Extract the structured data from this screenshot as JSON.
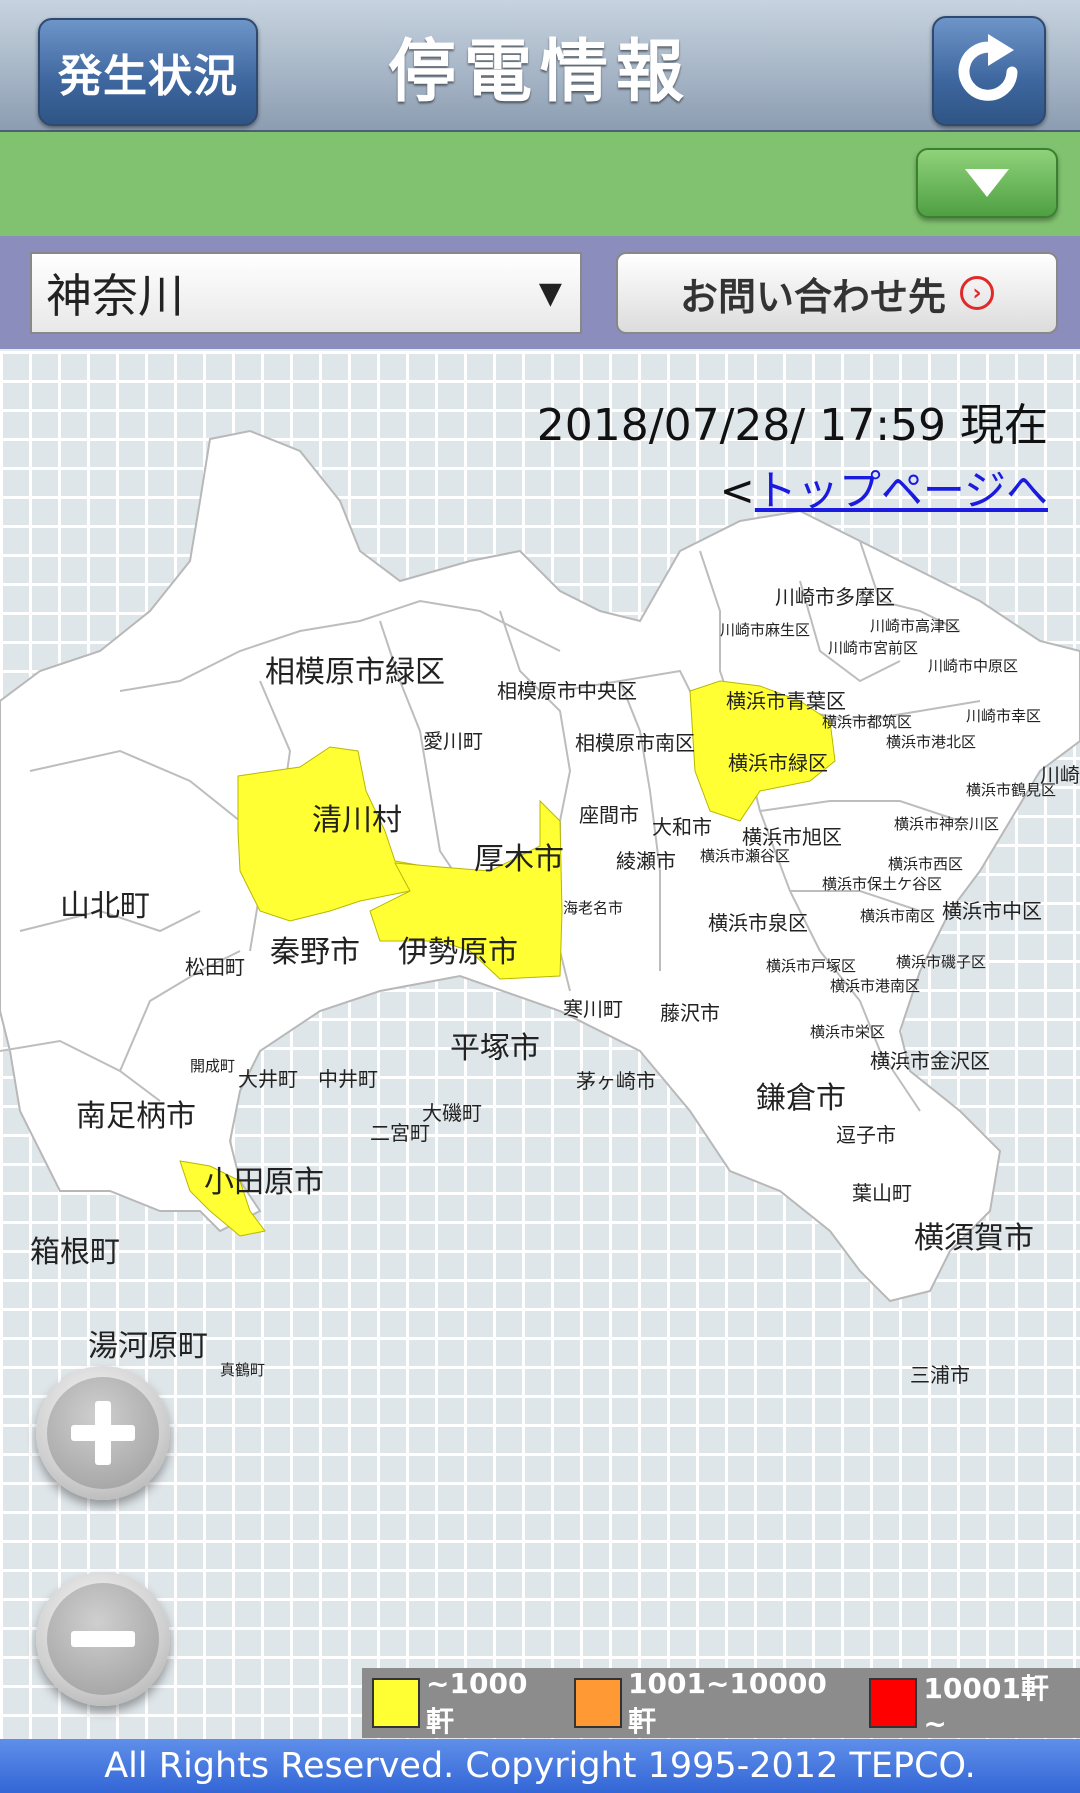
{
  "header": {
    "status_button": "発生状況",
    "title": "停電情報",
    "refresh_icon": "refresh-icon"
  },
  "toolbar": {
    "dropdown_icon": "chevron-down-icon"
  },
  "region": {
    "selected": "神奈川",
    "contact_button": "お問い合わせ先"
  },
  "map": {
    "timestamp": "2018/07/28/ 17:59 現在",
    "top_link_prefix": "<",
    "top_link": "トップページへ",
    "affected_color": "#ffff33",
    "labels": [
      {
        "text": "相模原市緑区",
        "size": "lg"
      },
      {
        "text": "相模原市中央区",
        "size": "md"
      },
      {
        "text": "相模原市南区",
        "size": "md"
      },
      {
        "text": "愛川町",
        "size": "md"
      },
      {
        "text": "清川村",
        "size": "lg"
      },
      {
        "text": "厚木市",
        "size": "lg"
      },
      {
        "text": "山北町",
        "size": "lg"
      },
      {
        "text": "座間市",
        "size": "md"
      },
      {
        "text": "大和市",
        "size": "md"
      },
      {
        "text": "綾瀬市",
        "size": "md"
      },
      {
        "text": "海老名市",
        "size": "sm"
      },
      {
        "text": "秦野市",
        "size": "lg"
      },
      {
        "text": "伊勢原市",
        "size": "lg"
      },
      {
        "text": "松田町",
        "size": "md"
      },
      {
        "text": "平塚市",
        "size": "lg"
      },
      {
        "text": "寒川町",
        "size": "md"
      },
      {
        "text": "藤沢市",
        "size": "md"
      },
      {
        "text": "茅ヶ崎市",
        "size": "md"
      },
      {
        "text": "開成町",
        "size": "sm"
      },
      {
        "text": "大井町",
        "size": "md"
      },
      {
        "text": "中井町",
        "size": "md"
      },
      {
        "text": "大磯町",
        "size": "md"
      },
      {
        "text": "二宮町",
        "size": "md"
      },
      {
        "text": "南足柄市",
        "size": "lg"
      },
      {
        "text": "小田原市",
        "size": "lg"
      },
      {
        "text": "箱根町",
        "size": "lg"
      },
      {
        "text": "湯河原町",
        "size": "lg"
      },
      {
        "text": "真鶴町",
        "size": "sm"
      },
      {
        "text": "鎌倉市",
        "size": "lg"
      },
      {
        "text": "逗子市",
        "size": "md"
      },
      {
        "text": "葉山町",
        "size": "md"
      },
      {
        "text": "横須賀市",
        "size": "lg"
      },
      {
        "text": "三浦市",
        "size": "md"
      },
      {
        "text": "川崎市多摩区",
        "size": "md"
      },
      {
        "text": "川崎市麻生区",
        "size": "sm"
      },
      {
        "text": "川崎市高津区",
        "size": "sm"
      },
      {
        "text": "川崎市宮前区",
        "size": "sm"
      },
      {
        "text": "川崎市中原区",
        "size": "sm"
      },
      {
        "text": "川崎市幸区",
        "size": "sm"
      },
      {
        "text": "川崎",
        "size": "md"
      },
      {
        "text": "横浜市青葉区",
        "size": "md"
      },
      {
        "text": "横浜市都筑区",
        "size": "sm"
      },
      {
        "text": "横浜市港北区",
        "size": "sm"
      },
      {
        "text": "横浜市緑区",
        "size": "md"
      },
      {
        "text": "横浜市鶴見区",
        "size": "sm"
      },
      {
        "text": "横浜市旭区",
        "size": "md"
      },
      {
        "text": "横浜市瀬谷区",
        "size": "sm"
      },
      {
        "text": "横浜市神奈川区",
        "size": "sm"
      },
      {
        "text": "横浜市西区",
        "size": "sm"
      },
      {
        "text": "横浜市保土ケ谷区",
        "size": "sm"
      },
      {
        "text": "横浜市中区",
        "size": "md"
      },
      {
        "text": "横浜市南区",
        "size": "sm"
      },
      {
        "text": "横浜市泉区",
        "size": "md"
      },
      {
        "text": "横浜市戸塚区",
        "size": "sm"
      },
      {
        "text": "横浜市磯子区",
        "size": "sm"
      },
      {
        "text": "横浜市港南区",
        "size": "sm"
      },
      {
        "text": "横浜市栄区",
        "size": "sm"
      },
      {
        "text": "横浜市金沢区",
        "size": "md"
      }
    ]
  },
  "zoom": {
    "in_icon": "plus-icon",
    "out_icon": "minus-icon"
  },
  "legend": [
    {
      "label": "~1000軒",
      "color": "#ffff33"
    },
    {
      "label": "1001~10000軒",
      "color": "#ff9933"
    },
    {
      "label": "10001軒~",
      "color": "#ff0000"
    }
  ],
  "footer": {
    "copyright": "All Rights Reserved. Copyright 1995-2012 TEPCO."
  }
}
